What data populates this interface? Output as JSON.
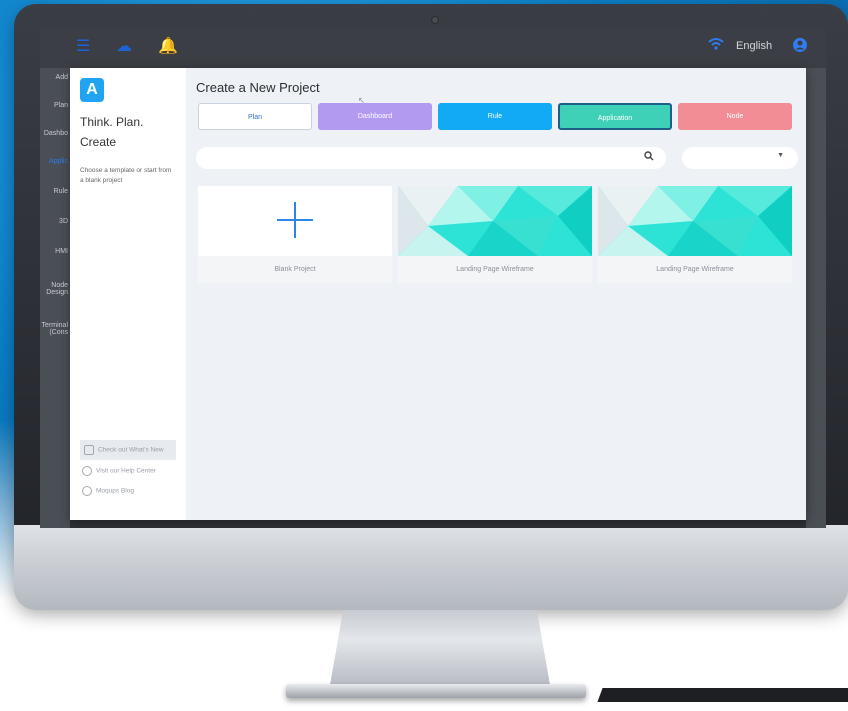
{
  "topbar": {
    "icons": [
      "menu-icon",
      "cloud-icon",
      "bell-icon"
    ],
    "language": "English",
    "right_icons": [
      "wifi-icon",
      "user-icon"
    ]
  },
  "bg_sidebar": {
    "items": [
      "Add",
      "Plan",
      "Dashbo",
      "Applic",
      "Rule",
      "3D",
      "HMI",
      "Node Design",
      "Terminal (Cons"
    ]
  },
  "left_panel": {
    "logo_icon": "app-logo-icon",
    "tagline_line1": "Think. Plan.",
    "tagline_line2": "Create",
    "subtext": "Choose a template or start from a blank project",
    "help_links": [
      {
        "label": "Check out What's New",
        "icon": "gift-icon"
      },
      {
        "label": "Visit our Help Center",
        "icon": "help-icon"
      },
      {
        "label": "Moqups Blog",
        "icon": "blog-icon"
      }
    ]
  },
  "main": {
    "title": "Create a New Project",
    "tabs": [
      {
        "label": "Plan",
        "color": "#ffffff"
      },
      {
        "label": "Dashboard",
        "color": "#b19aef"
      },
      {
        "label": "Rule",
        "color": "#13aaf5"
      },
      {
        "label": "Application",
        "color": "#3ed1b8"
      },
      {
        "label": "Node",
        "color": "#f28c95"
      }
    ],
    "search": {
      "placeholder": "",
      "icon": "search-icon"
    },
    "filter_select": {
      "value": "",
      "icon": "chevron-down-icon"
    },
    "cards": [
      {
        "caption": "Blank Project",
        "thumb": "plus-icon"
      },
      {
        "caption": "Landing Page Wireframe",
        "thumb": "teal-geometric-thumbnail"
      },
      {
        "caption": "Landing Page Wireframe",
        "thumb": "teal-geometric-thumbnail"
      }
    ]
  },
  "colors": {
    "accent_blue": "#1fa3f2",
    "background_blue": "#0b7fc6",
    "teal": "#3ed1b8"
  }
}
